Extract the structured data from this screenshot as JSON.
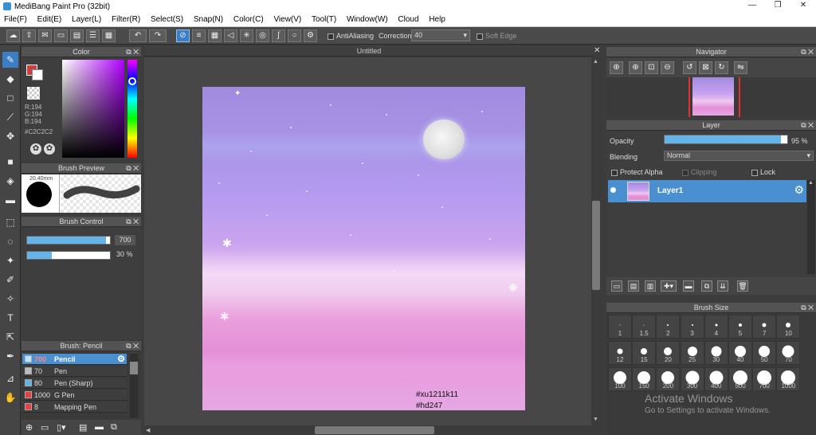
{
  "window": {
    "title": "MediBang Paint Pro (32bit)",
    "minimize": "—",
    "maximize": "❐",
    "close": "✕"
  },
  "menu": [
    "File(F)",
    "Edit(E)",
    "Layer(L)",
    "Filter(R)",
    "Select(S)",
    "Snap(N)",
    "Color(C)",
    "View(V)",
    "Tool(T)",
    "Window(W)",
    "Cloud",
    "Help"
  ],
  "toolbar": {
    "antialiasing_label": "AntiAliasing",
    "correction_label": "Correction",
    "correction_value": "40",
    "soft_edge_label": "Soft Edge"
  },
  "color_panel": {
    "title": "Color",
    "r": "R:194",
    "g": "G:194",
    "b": "B:194",
    "hex": "#C2C2C2",
    "current_color": "#c2c2c2",
    "accent": "#c94040"
  },
  "brush_preview": {
    "title": "Brush Preview",
    "size_label": "20.40mm"
  },
  "brush_control": {
    "title": "Brush Control",
    "size_value": "700",
    "opacity_value": "30 %",
    "size_fill": 0.95,
    "opacity_fill": 0.3
  },
  "brush_list": {
    "title": "Brush: Pencil",
    "items": [
      {
        "num": "700",
        "name": "Pencil",
        "color": "#bde3ff",
        "selected": true
      },
      {
        "num": "70",
        "name": "Pen",
        "color": "#bbbbbb",
        "selected": false
      },
      {
        "num": "80",
        "name": "Pen (Sharp)",
        "color": "#5ab4e8",
        "selected": false
      },
      {
        "num": "1000",
        "name": "G Pen",
        "color": "#e84040",
        "selected": false
      },
      {
        "num": "8",
        "name": "Mapping Pen",
        "color": "#e84040",
        "selected": false
      }
    ]
  },
  "document": {
    "tab_title": "Untitled",
    "signature_line1": "#xu1211k11",
    "signature_line2": "#hd247"
  },
  "navigator": {
    "title": "Navigator"
  },
  "layer_panel": {
    "title": "Layer",
    "opacity_label": "Opacity",
    "opacity_value": "95 %",
    "opacity_fill": 0.95,
    "blending_label": "Blending",
    "blending_value": "Normal",
    "protect_alpha_label": "Protect Alpha",
    "clipping_label": "Clipping",
    "lock_label": "Lock",
    "layers": [
      {
        "name": "Layer1"
      }
    ]
  },
  "brush_size": {
    "title": "Brush Size",
    "sizes": [
      "1",
      "1.5",
      "2",
      "3",
      "4",
      "5",
      "7",
      "10",
      "12",
      "15",
      "20",
      "25",
      "30",
      "40",
      "50",
      "70",
      "100",
      "150",
      "200",
      "300",
      "400",
      "500",
      "700",
      "1000"
    ]
  },
  "watermark": {
    "line1": "Activate Windows",
    "line2": "Go to Settings to activate Windows."
  },
  "colors": {
    "accent_blue": "#5b9bd5",
    "selection_blue": "#4a8fd0"
  }
}
